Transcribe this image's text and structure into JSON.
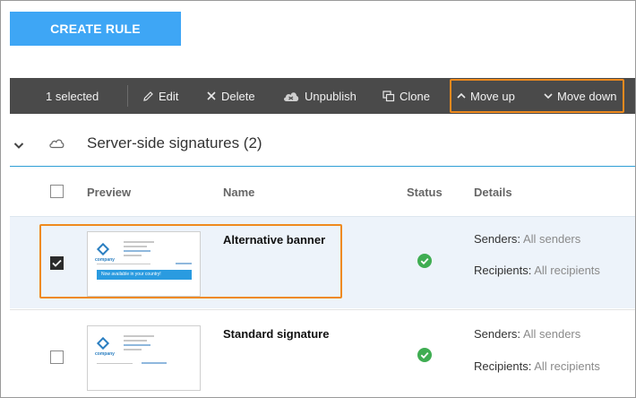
{
  "toolbar_top": {
    "create_rule_label": "CREATE RULE"
  },
  "toolbar": {
    "selected_label": "1 selected",
    "edit_label": "Edit",
    "delete_label": "Delete",
    "unpublish_label": "Unpublish",
    "clone_label": "Clone",
    "move_up_label": "Move up",
    "move_down_label": "Move down",
    "icons": [
      "pencil-icon",
      "close-icon",
      "cloud-icon",
      "clone-icon",
      "chevron-up-icon",
      "chevron-down-icon"
    ],
    "highlight_color": "#ef8a1e"
  },
  "group": {
    "title": "Server-side signatures (2)",
    "icons": [
      "chevron-down-icon",
      "cloud-icon"
    ],
    "accent_color": "#2f9fd6"
  },
  "table": {
    "columns": [
      "Preview",
      "Name",
      "Status",
      "Details"
    ],
    "rows": [
      {
        "name": "Alternative banner",
        "selected": true,
        "status": "active",
        "senders_label": "Senders:",
        "senders_value": "All senders",
        "recipients_label": "Recipients:",
        "recipients_value": "All recipients",
        "preview_brand": "company",
        "preview_banner": "Now available in your country!"
      },
      {
        "name": "Standard signature",
        "selected": false,
        "status": "active",
        "senders_label": "Senders:",
        "senders_value": "All senders",
        "recipients_label": "Recipients:",
        "recipients_value": "All recipients",
        "preview_brand": "company"
      }
    ]
  },
  "colors": {
    "primary_button": "#3ea6f5",
    "toolbar_bg": "#4a4a4a",
    "selected_row_bg": "#edf3fa",
    "status_green": "#3fad52"
  }
}
